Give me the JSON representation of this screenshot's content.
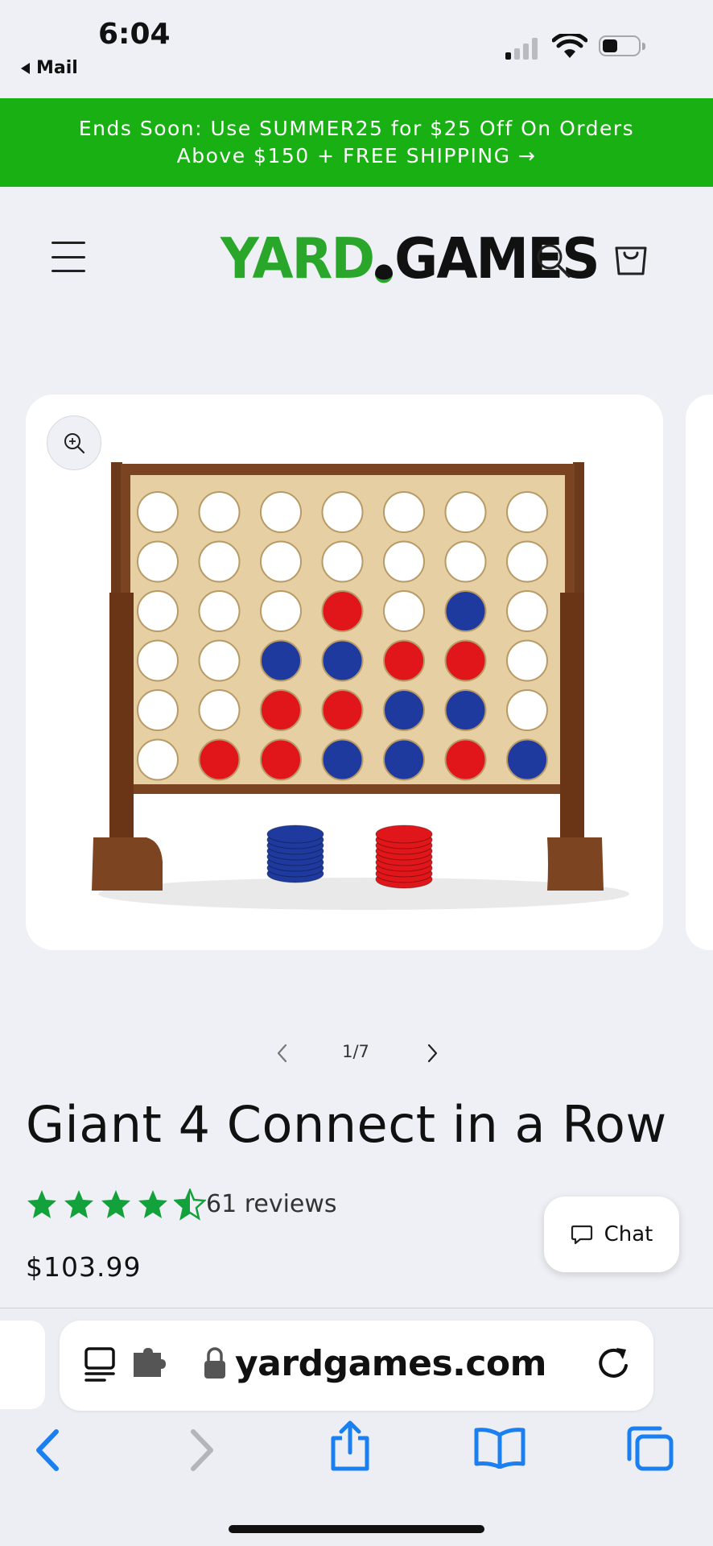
{
  "status_bar": {
    "time": "6:04",
    "back_label": "Mail"
  },
  "banner": {
    "line1": "Ends Soon: Use SUMMER25 for $25 Off On Orders",
    "line2": "Above $150 + FREE SHIPPING →"
  },
  "header": {
    "logo_part1": "YARD",
    "logo_part2": "GAMES",
    "icons": [
      "menu-icon",
      "search-icon",
      "cart-icon"
    ]
  },
  "gallery": {
    "counter": "1/7",
    "board_rows": [
      [
        "w",
        "w",
        "w",
        "w",
        "w",
        "w",
        "w"
      ],
      [
        "w",
        "w",
        "w",
        "w",
        "w",
        "w",
        "w"
      ],
      [
        "w",
        "w",
        "w",
        "r",
        "w",
        "b",
        "w"
      ],
      [
        "w",
        "w",
        "b",
        "b",
        "r",
        "r",
        "w"
      ],
      [
        "w",
        "w",
        "r",
        "r",
        "b",
        "b",
        "w"
      ],
      [
        "w",
        "r",
        "r",
        "b",
        "b",
        "r",
        "b"
      ]
    ]
  },
  "product": {
    "title": "Giant 4 Connect in a Row",
    "rating": 4.5,
    "reviews_label": "61 reviews",
    "price": "$103.99"
  },
  "chat": {
    "label": "Chat"
  },
  "browser": {
    "url": "yardgames.com"
  },
  "colors": {
    "banner_green": "#18b013",
    "logo_green": "#2aa72a",
    "star_green": "#12a13a",
    "ios_blue": "#1a7ff0",
    "disc_red": "#e0161a",
    "disc_blue": "#1f3a9e"
  }
}
